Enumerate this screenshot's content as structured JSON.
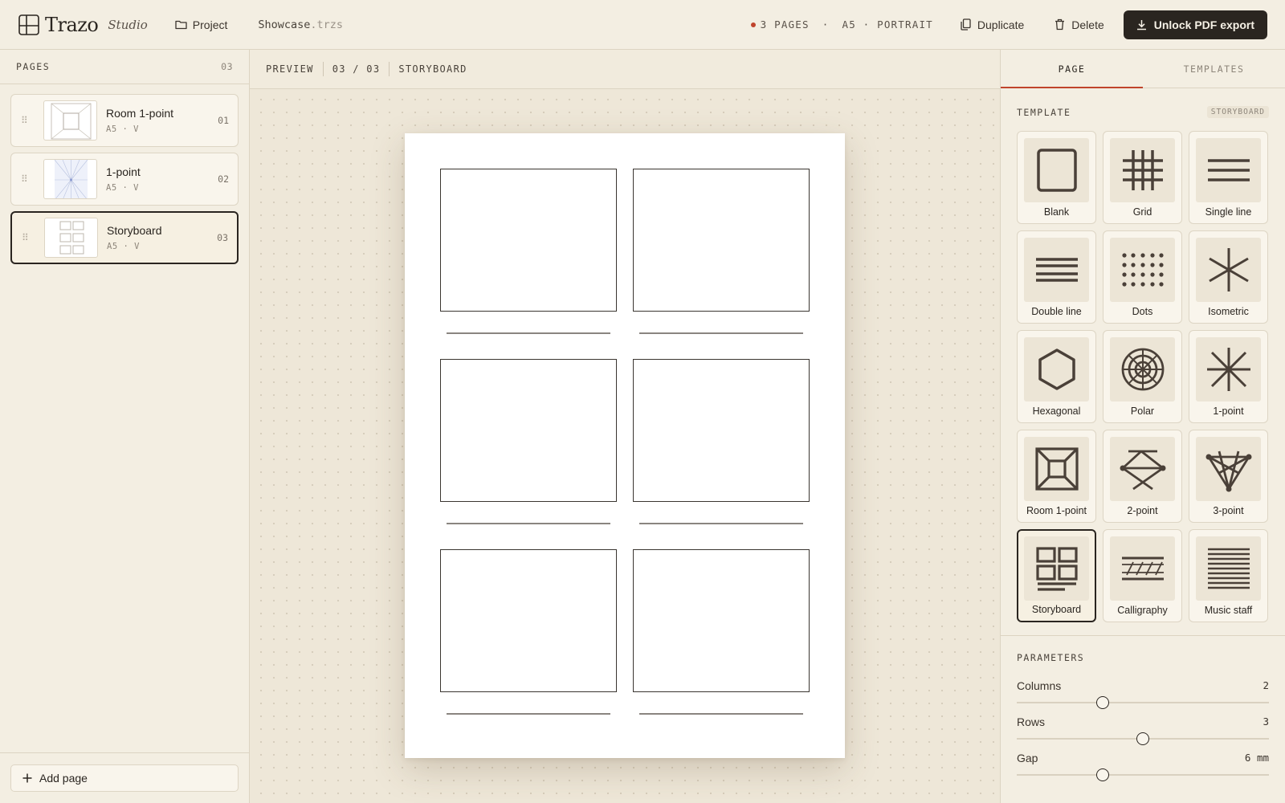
{
  "app": {
    "logo_name": "Trazo",
    "logo_suffix": "Studio",
    "project_label": "Project",
    "file_base": "Showcase",
    "file_ext": ".trzs",
    "status_pages": "3 PAGES",
    "status_sep": "·",
    "status_format": "A5 · PORTRAIT",
    "duplicate_label": "Duplicate",
    "delete_label": "Delete",
    "unlock_label": "Unlock PDF export",
    "status_dot_color": "#c0442c"
  },
  "sidebar": {
    "title": "PAGES",
    "count": "03",
    "pages": [
      {
        "name": "Room 1-point",
        "meta": "A5 · V",
        "num": "01",
        "thumb": "room-1-point"
      },
      {
        "name": "1-point",
        "meta": "A5 · V",
        "num": "02",
        "thumb": "one-point"
      },
      {
        "name": "Storyboard",
        "meta": "A5 · V",
        "num": "03",
        "thumb": "storyboard",
        "active": true
      }
    ],
    "add_page_label": "Add page"
  },
  "preview": {
    "label": "PREVIEW",
    "position": "03 / 03",
    "template": "STORYBOARD"
  },
  "panel": {
    "tabs": [
      "PAGE",
      "TEMPLATES"
    ],
    "active_tab": "PAGE",
    "template_heading": "TEMPLATE",
    "template_tag": "STORYBOARD",
    "templates": [
      {
        "label": "Blank",
        "icon": "blank-icon"
      },
      {
        "label": "Grid",
        "icon": "grid-icon"
      },
      {
        "label": "Single line",
        "icon": "single-line-icon"
      },
      {
        "label": "Double line",
        "icon": "double-line-icon"
      },
      {
        "label": "Dots",
        "icon": "dots-icon"
      },
      {
        "label": "Isometric",
        "icon": "isometric-icon"
      },
      {
        "label": "Hexagonal",
        "icon": "hexagon-icon"
      },
      {
        "label": "Polar",
        "icon": "polar-icon"
      },
      {
        "label": "1-point",
        "icon": "one-point-icon"
      },
      {
        "label": "Room 1-point",
        "icon": "room-one-point-icon"
      },
      {
        "label": "2-point",
        "icon": "two-point-icon"
      },
      {
        "label": "3-point",
        "icon": "three-point-icon"
      },
      {
        "label": "Storyboard",
        "icon": "storyboard-icon",
        "active": true
      },
      {
        "label": "Calligraphy",
        "icon": "calligraphy-icon"
      },
      {
        "label": "Music staff",
        "icon": "music-staff-icon"
      }
    ],
    "params_heading": "PARAMETERS",
    "params": [
      {
        "label": "Columns",
        "value": "2",
        "level": 0.34
      },
      {
        "label": "Rows",
        "value": "3",
        "level": 0.5
      },
      {
        "label": "Gap",
        "value": "6 mm",
        "level": 0.34
      }
    ]
  }
}
